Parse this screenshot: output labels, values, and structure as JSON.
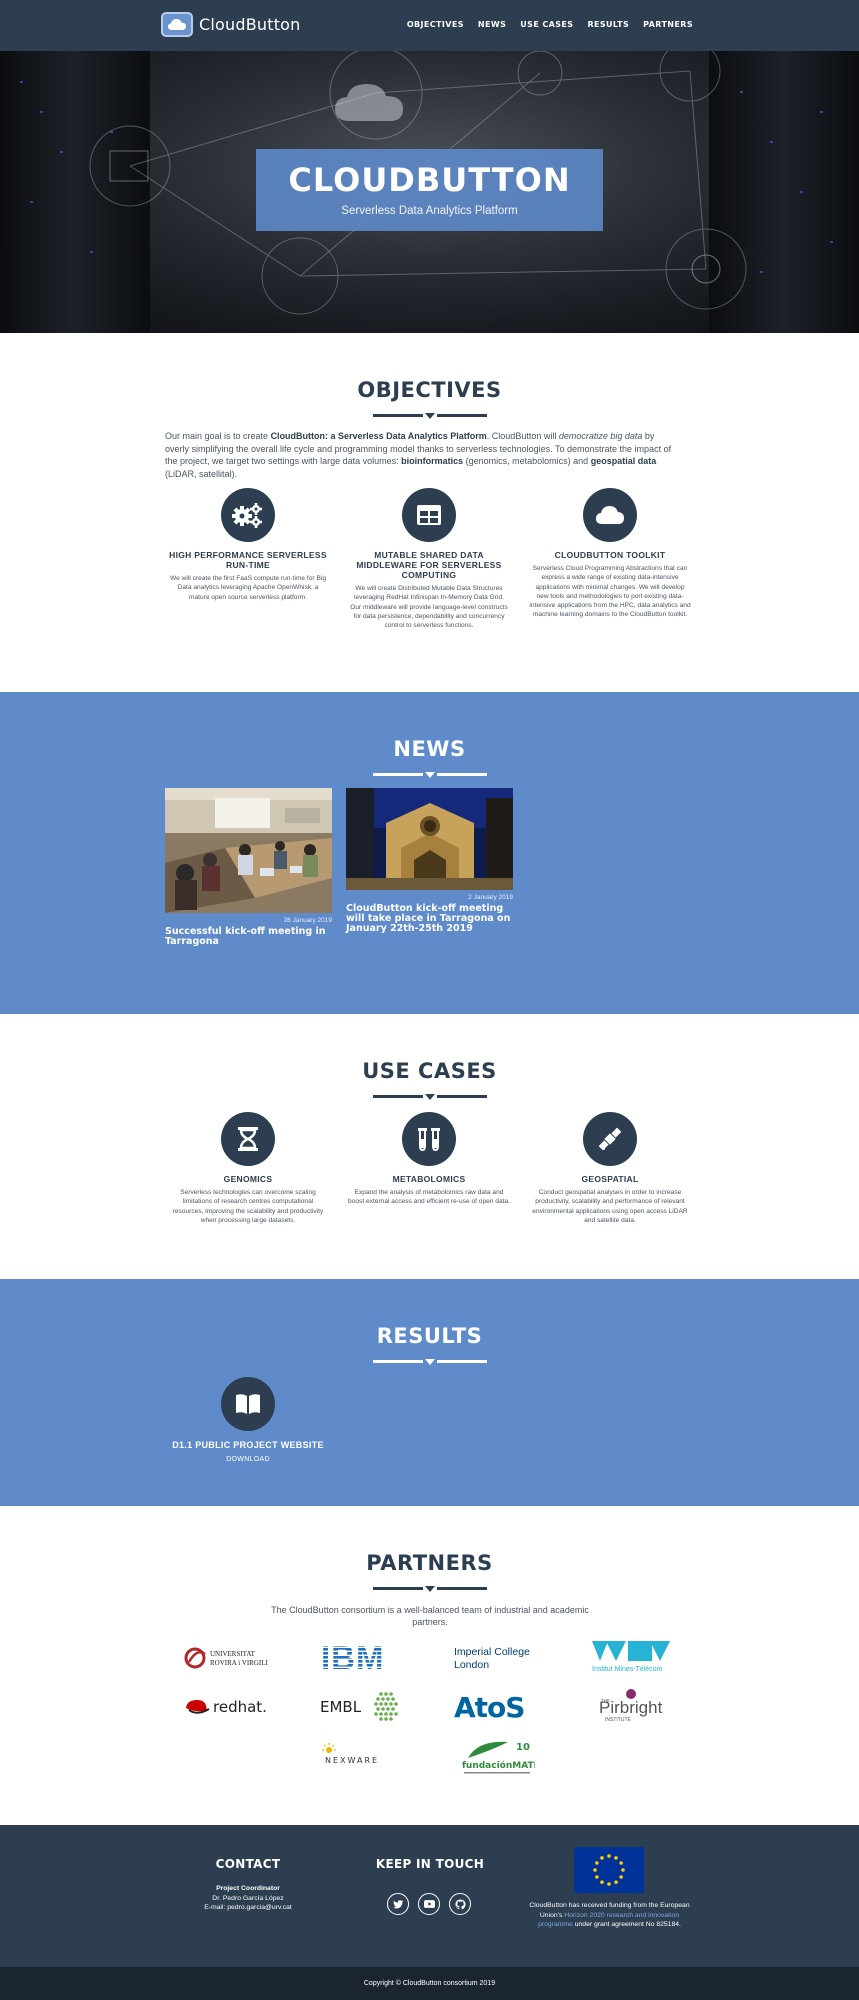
{
  "nav": {
    "brand": "CloudButton",
    "links": [
      "OBJECTIVES",
      "NEWS",
      "USE CASES",
      "RESULTS",
      "PARTNERS"
    ]
  },
  "hero": {
    "title": "CLOUDBUTTON",
    "subtitle": "Serverless Data Analytics Platform"
  },
  "objectives": {
    "title": "OBJECTIVES",
    "intro": {
      "p1": "Our main goal is to create ",
      "b1": "CloudButton: a Serverless Data Analytics Platform",
      "p2": ". CloudButton will ",
      "i1": "democratize big data",
      "p3": " by overly simplifying the overall life cycle and programming model thanks to serverless technologies. To demonstrate the impact of the project, we target two settings with large data volumes: ",
      "b2": "bioinformatics",
      "p4": " (genomics, metabolomics) and ",
      "b3": "geospatial data",
      "p5": " (LiDAR, satellital)."
    },
    "items": [
      {
        "icon": "gears-icon",
        "title": "HIGH PERFORMANCE SERVERLESS RUN-TIME",
        "text": "We will create the first FaaS compute run-time for Big Data analytics leveraging Apache OpenWhisk, a mature open source serverless platform."
      },
      {
        "icon": "table-icon",
        "title": "MUTABLE SHARED DATA MIDDLEWARE FOR SERVERLESS COMPUTING",
        "text": "We will create Distributed Mutable Data Structures leveraging RedHat Infinispan In-Memory Data Grid. Our middleware will provide language-level constructs for data persistence, dependability and concurrency control to serverless functions."
      },
      {
        "icon": "cloud-icon",
        "title": "CLOUDBUTTON TOOLKIT",
        "text": "Serverless Cloud Programming Abstractions that can express a wide range of existing data-intensive applications with minimal changes. We will develop new tools and methodologies to port existing data-intensive applications from the HPC, data analytics and machine learning domains to the CloudButton toolkit."
      }
    ]
  },
  "news": {
    "title": "NEWS",
    "items": [
      {
        "date": "28 January 2019",
        "title": "Successful kick-off meeting in Tarragona"
      },
      {
        "date": "2 January 2019",
        "title": "CloudButton kick-off meeting will take place in Tarragona on January 22th-25th 2019"
      }
    ]
  },
  "usecases": {
    "title": "USE CASES",
    "items": [
      {
        "icon": "hourglass-icon",
        "title": "GENOMICS",
        "text": "Serverless technologies can overcome scaling limitations of research centres computational resources, improving the scalability and productivity when processing large datasets."
      },
      {
        "icon": "test-tubes-icon",
        "title": "METABOLOMICS",
        "text": "Expand the analysis of metabolomics raw data and boost external access and efficient re-use of open data."
      },
      {
        "icon": "satellite-icon",
        "title": "GEOSPATIAL",
        "text": "Conduct geospatial analyses in order to increase productivity, scalability and performance of relevant environmental applications using open access LiDAR and satellite data."
      }
    ]
  },
  "results": {
    "title": "RESULTS",
    "items": [
      {
        "icon": "book-icon",
        "title": "D1.1 PUBLIC PROJECT WEBSITE",
        "link": "DOWNLOAD"
      }
    ]
  },
  "partners": {
    "title": "PARTNERS",
    "intro": "The CloudButton consortium is a well-balanced team of industrial and academic partners.",
    "logos": {
      "urv1": "UNIVERSITAT",
      "urv2": "ROVIRA i VIRGILI",
      "ibm": "IBM",
      "imperial1": "Imperial College",
      "imperial2": "London",
      "imt": "Institut Mines-Télécom",
      "redhat": "redhat.",
      "embl": "EMBL",
      "atos": "AtoS",
      "pirbright_the": "THE",
      "pirbright": "Pirbright",
      "pirbright_inst": "INSTITUTE",
      "nexware": "NEXWARE",
      "matrix": "fundaciónMATRIX",
      "matrix_years": "10"
    }
  },
  "footer": {
    "contact_title": "CONTACT",
    "contact_role": "Project Coordinator",
    "contact_name": "Dr. Pedro García López",
    "contact_email": "E-mail: pedro.garcia@urv.cat",
    "keep_title": "KEEP IN TOUCH",
    "eu_text1": "CloudButton has received funding from the European Union's ",
    "eu_link": "Horizon 2020 research and innovation programme",
    "eu_text2": " under grant agreement No 825184.",
    "copyright": "Copyright © CloudButton consortium 2019"
  },
  "colors": {
    "navy": "#2c3e50",
    "blue": "#5f8bcb",
    "link": "#7fa7df"
  }
}
